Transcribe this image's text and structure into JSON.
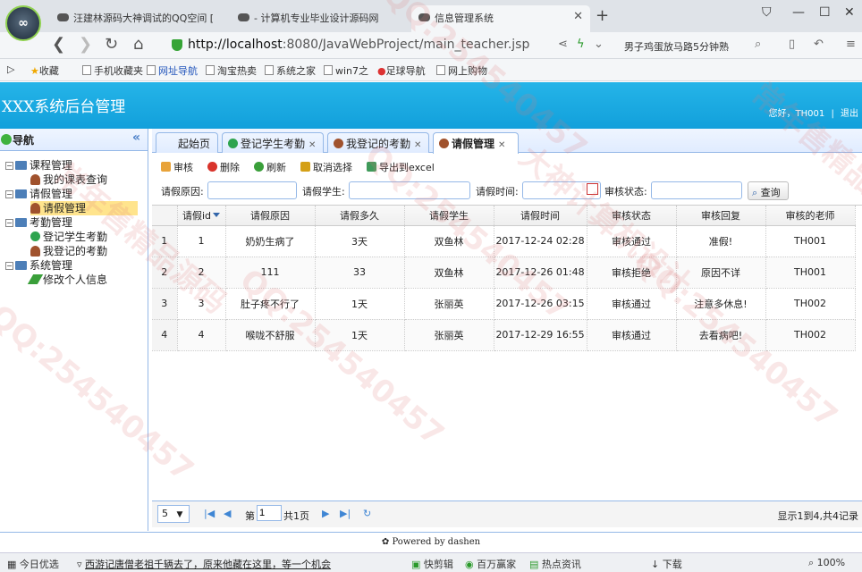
{
  "browser": {
    "logo_text": "∞",
    "tabs": [
      {
        "label": "汪建林源码大神调试的QQ空间 [",
        "active": false
      },
      {
        "label": "- 计算机专业毕业设计源码网",
        "active": false
      },
      {
        "label": "信息管理系统",
        "active": true
      }
    ],
    "url_host": "http://localhost",
    "url_path": ":8080/JavaWebProject/main_teacher.jsp",
    "search_text": "男子鸡蛋放马路5分钟熟",
    "bookmarks": [
      "收藏",
      "手机收藏夹",
      "网址导航",
      "淘宝热卖",
      "系统之家",
      "win7之",
      "足球导航",
      "网上购物"
    ]
  },
  "app": {
    "title": "XXX系统后台管理",
    "greeting": "您好，",
    "username": "TH001",
    "logout": "退出"
  },
  "sidebar": {
    "header": "导航",
    "tree": [
      {
        "label": "课程管理",
        "level": 0
      },
      {
        "label": "我的课表查询",
        "level": 1
      },
      {
        "label": "请假管理",
        "level": 0
      },
      {
        "label": "请假管理",
        "level": 1,
        "selected": true
      },
      {
        "label": "考勤管理",
        "level": 0
      },
      {
        "label": "登记学生考勤",
        "level": 1
      },
      {
        "label": "我登记的考勤",
        "level": 1
      },
      {
        "label": "系统管理",
        "level": 0
      },
      {
        "label": "修改个人信息",
        "level": 1
      }
    ]
  },
  "tabs": [
    {
      "label": "起始页"
    },
    {
      "label": "登记学生考勤"
    },
    {
      "label": "我登记的考勤"
    },
    {
      "label": "请假管理"
    }
  ],
  "toolbar": {
    "audit": "审核",
    "delete": "删除",
    "refresh": "刷新",
    "cancel_select": "取消选择",
    "export": "导出到excel"
  },
  "filters": {
    "reason_label": "请假原因:",
    "student_label": "请假学生:",
    "time_label": "请假时间:",
    "status_label": "审核状态:",
    "search_btn": "查询"
  },
  "grid": {
    "columns": [
      "请假id",
      "请假原因",
      "请假多久",
      "请假学生",
      "请假时间",
      "审核状态",
      "审核回复",
      "审核的老师"
    ],
    "rows": [
      {
        "rn": "1",
        "cells": [
          "1",
          "奶奶生病了",
          "3天",
          "双鱼林",
          "2017-12-24 02:28",
          "审核通过",
          "准假!",
          "TH001"
        ]
      },
      {
        "rn": "2",
        "cells": [
          "2",
          "111",
          "33",
          "双鱼林",
          "2017-12-26 01:48",
          "审核拒绝",
          "原因不详",
          "TH001"
        ]
      },
      {
        "rn": "3",
        "cells": [
          "3",
          "肚子疼不行了",
          "1天",
          "张丽英",
          "2017-12-26 03:15",
          "审核通过",
          "注意多休息!",
          "TH002"
        ]
      },
      {
        "rn": "4",
        "cells": [
          "4",
          "喉咙不舒服",
          "1天",
          "张丽英",
          "2017-12-29 16:55",
          "审核通过",
          "去看病吧!",
          "TH002"
        ]
      }
    ]
  },
  "pager": {
    "page_size": "5",
    "page_prefix": "第",
    "page_value": "1",
    "page_suffix": "共1页",
    "summary": "显示1到4,共4记录"
  },
  "footer": "Powered by dashen",
  "statusbar": {
    "today": "今日优选",
    "news": "西游记唐僧老祖千辆去了，原来他藏在这里，等一个机会",
    "items": [
      "快剪辑",
      "百万赢家",
      "热点资讯",
      "下载"
    ],
    "zoom": "100%"
  },
  "watermarks": [
    "QQ:254540457",
    "大神计算机设计",
    "常年售精品源码"
  ]
}
